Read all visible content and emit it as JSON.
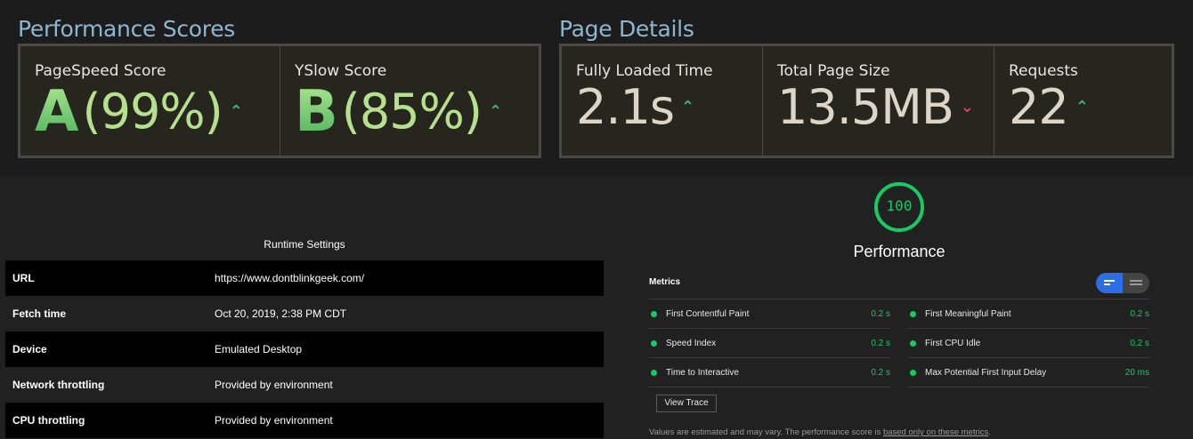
{
  "performance_scores": {
    "title": "Performance Scores",
    "pagespeed": {
      "label": "PageSpeed Score",
      "grade": "A",
      "percent": "(99%)",
      "trend": "up"
    },
    "yslow": {
      "label": "YSlow Score",
      "grade": "B",
      "percent": "(85%)",
      "trend": "up"
    }
  },
  "page_details": {
    "title": "Page Details",
    "fully_loaded": {
      "label": "Fully Loaded Time",
      "value": "2.1s",
      "trend": "up"
    },
    "page_size": {
      "label": "Total Page Size",
      "value": "13.5MB",
      "trend": "down"
    },
    "requests": {
      "label": "Requests",
      "value": "22",
      "trend": "up"
    }
  },
  "runtime": {
    "title": "Runtime Settings",
    "rows": [
      {
        "key": "URL",
        "value": "https://www.dontblinkgeek.com/"
      },
      {
        "key": "Fetch time",
        "value": "Oct 20, 2019, 2:38 PM CDT"
      },
      {
        "key": "Device",
        "value": "Emulated Desktop"
      },
      {
        "key": "Network throttling",
        "value": "Provided by environment"
      },
      {
        "key": "CPU throttling",
        "value": "Provided by environment"
      }
    ]
  },
  "lighthouse": {
    "score": "100",
    "score_fraction": 1.0,
    "category": "Performance",
    "metrics_header": "Metrics",
    "metrics_left": [
      {
        "name": "First Contentful Paint",
        "value": "0.2 s"
      },
      {
        "name": "Speed Index",
        "value": "0.2 s"
      },
      {
        "name": "Time to Interactive",
        "value": "0.2 s"
      }
    ],
    "metrics_right": [
      {
        "name": "First Meaningful Paint",
        "value": "0.2 s"
      },
      {
        "name": "First CPU Idle",
        "value": "0.2 s"
      },
      {
        "name": "Max Potential First Input Delay",
        "value": "20 ms"
      }
    ],
    "view_trace_label": "View Trace",
    "footnote_text": "Values are estimated and may vary. The performance score is ",
    "footnote_link": "based only on these metrics",
    "footnote_end": "."
  },
  "colors": {
    "accent_green": "#18c964",
    "trend_up": "#3fb66f",
    "trend_down": "#d9485b",
    "section_title": "#8fb6d0",
    "toggle_active": "#2c6ee6"
  },
  "icons": {
    "trend_up": "caret-up-icon",
    "trend_down": "caret-down-icon",
    "status": "pass-dot-icon",
    "toggle_left": "list-compact-icon",
    "toggle_right": "list-expanded-icon"
  }
}
